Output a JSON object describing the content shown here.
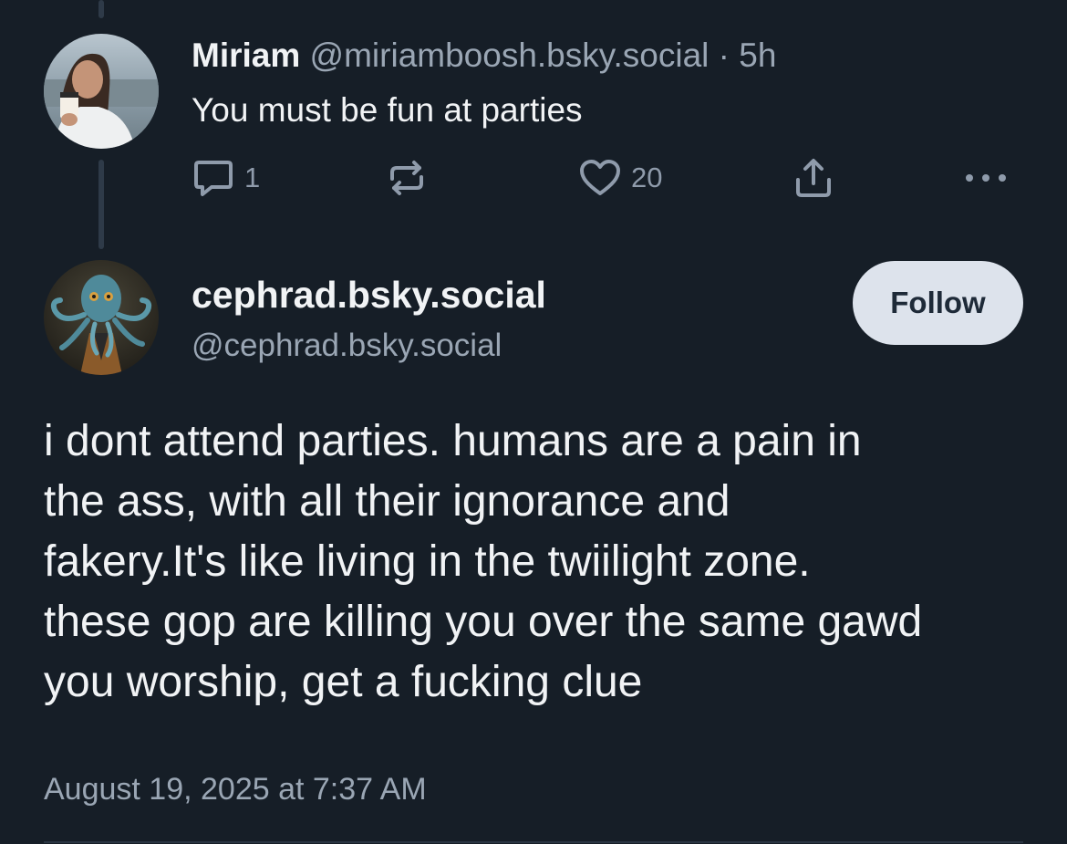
{
  "parent_post": {
    "author_name": "Miriam",
    "author_handle": "@miriamboosh.bsky.social",
    "separator": "·",
    "time_ago": "5h",
    "text": "You must be fun at parties",
    "reply_count": "1",
    "like_count": "20"
  },
  "main_post": {
    "display_name": "cephrad.bsky.social",
    "handle": "@cephrad.bsky.social",
    "follow_label": "Follow",
    "body_lines": [
      "i dont attend parties. humans are a pain in",
      "the ass, with all their ignorance and",
      "fakery.It's like living in the twiilight zone.",
      "these gop are killing you over the same gawd",
      "you worship, get a fucking clue"
    ],
    "timestamp": "August 19, 2025 at 7:37 AM"
  },
  "icons": {
    "reply": "reply-icon",
    "repost": "repost-icon",
    "like": "heart-icon",
    "share": "share-icon",
    "more": "more-icon"
  },
  "colors": {
    "background": "#161e27",
    "text_primary": "#f1f3f5",
    "text_secondary": "#9aa6b4",
    "follow_button_bg": "#dde3ec",
    "follow_button_text": "#1e2a38"
  }
}
